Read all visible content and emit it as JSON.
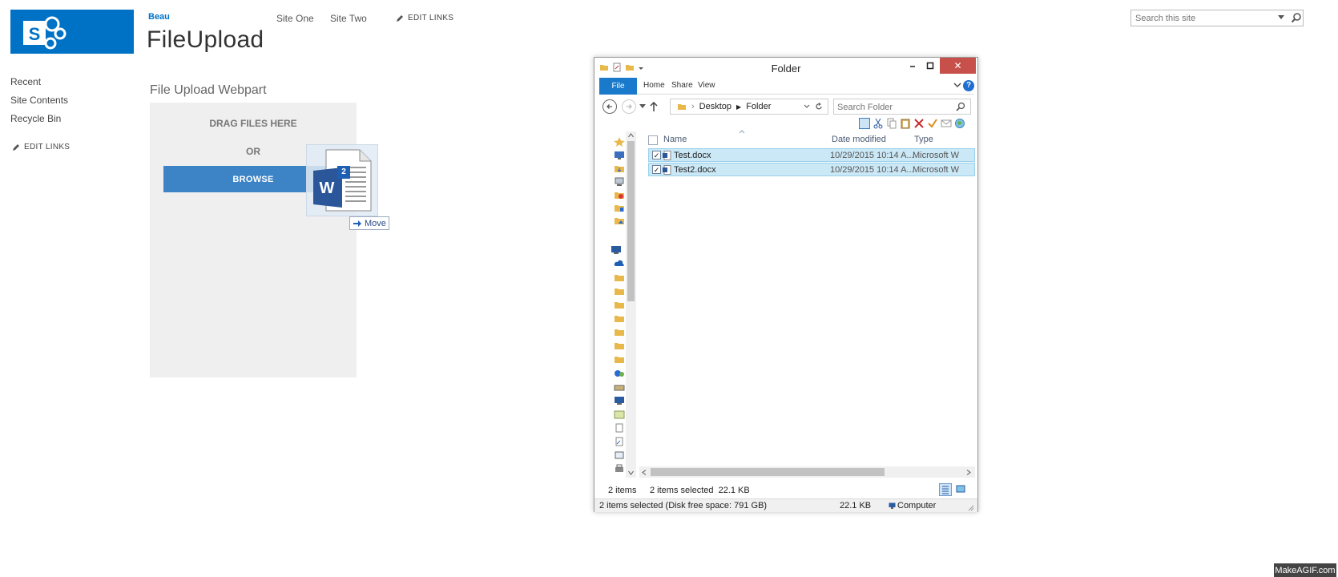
{
  "sharepoint": {
    "site_link": "Beau",
    "site_title": "FileUpload",
    "top_nav": [
      "Site One",
      "Site Two"
    ],
    "edit_links": "EDIT LINKS",
    "search_placeholder": "Search this site",
    "left_nav": [
      "Recent",
      "Site Contents",
      "Recycle Bin"
    ],
    "left_edit_links": "EDIT LINKS",
    "brand_color": "#0072c6"
  },
  "webpart": {
    "title": "File Upload Webpart",
    "drag_text": "DRAG FILES HERE",
    "or_text": "OR",
    "browse_label": "BROWSE",
    "drag_badge": "2",
    "move_label": "Move",
    "button_color": "#3c84c6"
  },
  "explorer": {
    "title": "Folder",
    "close_glyph": "✕",
    "ribbon_tabs": [
      "File",
      "Home",
      "Share",
      "View"
    ],
    "breadcrumb": [
      "Desktop",
      "Folder"
    ],
    "search_placeholder": "Search Folder",
    "columns": [
      "Name",
      "Date modified",
      "Type"
    ],
    "files": [
      {
        "name": "Test.docx",
        "date": "10/29/2015 10:14 A...",
        "type": "Microsoft W"
      },
      {
        "name": "Test2.docx",
        "date": "10/29/2015 10:14 A...",
        "type": "Microsoft W"
      }
    ],
    "status_items": "2 items",
    "status_selected": "2 items selected  22.1 KB",
    "details_text": "2 items selected (Disk free space: 791 GB)",
    "details_size": "22.1 KB",
    "details_location": "Computer",
    "selection_color": "#cbe8f6"
  },
  "watermark": "MakeAGIF.com"
}
